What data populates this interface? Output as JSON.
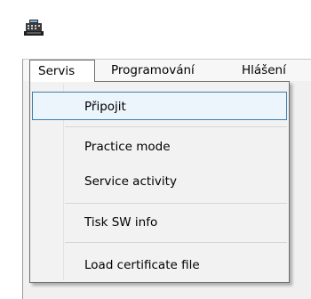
{
  "menubar": {
    "items": [
      {
        "label": "Servis"
      },
      {
        "label": "Programování"
      },
      {
        "label": "Hlášení"
      }
    ]
  },
  "dropdown": {
    "items": [
      {
        "label": "Připojit",
        "highlighted": true
      },
      {
        "label": "Practice mode"
      },
      {
        "label": "Service activity"
      },
      {
        "label": "Tisk SW info"
      },
      {
        "label": "Load certificate file"
      }
    ]
  },
  "icons": {
    "app": "cash-register-icon"
  },
  "colors": {
    "menu_background": "#f2f2f2",
    "highlight_fill": "#ecf4fc",
    "highlight_border": "#3c7fb1",
    "client_background": "#f0f0f0"
  }
}
